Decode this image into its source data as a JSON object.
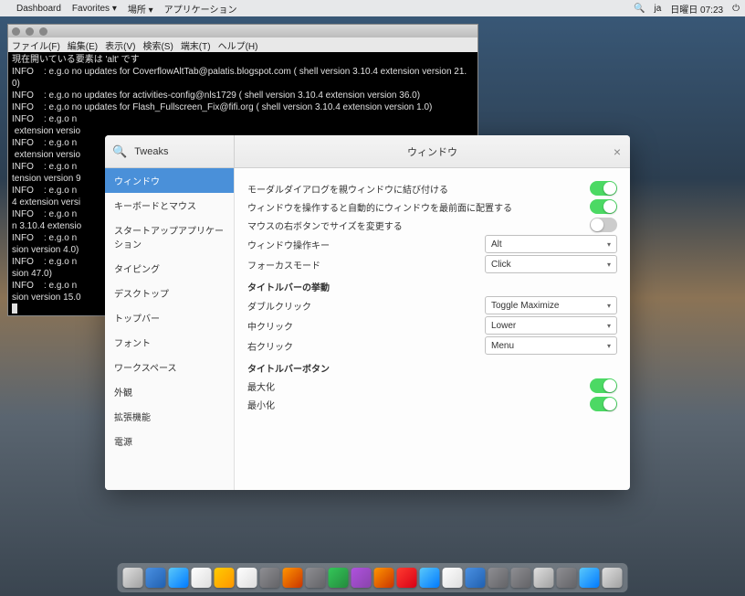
{
  "menubar": {
    "apple": "",
    "items": [
      "Dashboard",
      "Favorites ▾",
      "場所 ▾",
      "アプリケーション"
    ],
    "right": {
      "search": "🔍",
      "lang": "ja",
      "clock": "日曜日 07:23",
      "power": "⏻"
    }
  },
  "terminal": {
    "title": "",
    "menu": [
      "ファイル(F)",
      "編集(E)",
      "表示(V)",
      "検索(S)",
      "端末(T)",
      "ヘルプ(H)"
    ],
    "lines": [
      "現在開いている要素は 'alt' です",
      "INFO    : e.g.o no updates for CoverflowAltTab@palatis.blogspot.com ( shell version 3.10.4 extension version 21.0)",
      "INFO    : e.g.o no updates for activities-config@nls1729 ( shell version 3.10.4 extension version 36.0)",
      "INFO    : e.g.o no updates for Flash_Fullscreen_Fix@fifi.org ( shell version 3.10.4 extension version 1.0)",
      "INFO    : e.g.o n",
      " extension versio",
      "INFO    : e.g.o n",
      " extension versio",
      "INFO    : e.g.o n",
      "tension version 9",
      "INFO    : e.g.o n",
      "4 extension versi",
      "INFO    : e.g.o n",
      "n 3.10.4 extensio",
      "INFO    : e.g.o n",
      "sion version 4.0)",
      "INFO    : e.g.o n",
      "sion 47.0)",
      "INFO    : e.g.o n",
      "sion version 15.0"
    ]
  },
  "tweaks": {
    "app_title": "Tweaks",
    "panel_title": "ウィンドウ",
    "sidebar": [
      "ウィンドウ",
      "キーボードとマウス",
      "スタートアップアプリケーション",
      "タイピング",
      "デスクトップ",
      "トップバー",
      "フォント",
      "ワークスペース",
      "外観",
      "拡張機能",
      "電源"
    ],
    "rows": {
      "modal": "モーダルダイアログを親ウィンドウに結び付ける",
      "raise": "ウィンドウを操作すると自動的にウィンドウを最前面に配置する",
      "resize": "マウスの右ボタンでサイズを変更する",
      "modkey_label": "ウィンドウ操作キー",
      "modkey_value": "Alt",
      "focus_label": "フォーカスモード",
      "focus_value": "Click",
      "heading_title": "タイトルバーの挙動",
      "dbl_label": "ダブルクリック",
      "dbl_value": "Toggle Maximize",
      "mid_label": "中クリック",
      "mid_value": "Lower",
      "right_label": "右クリック",
      "right_value": "Menu",
      "heading_buttons": "タイトルバーボタン",
      "max_label": "最大化",
      "min_label": "最小化"
    }
  }
}
